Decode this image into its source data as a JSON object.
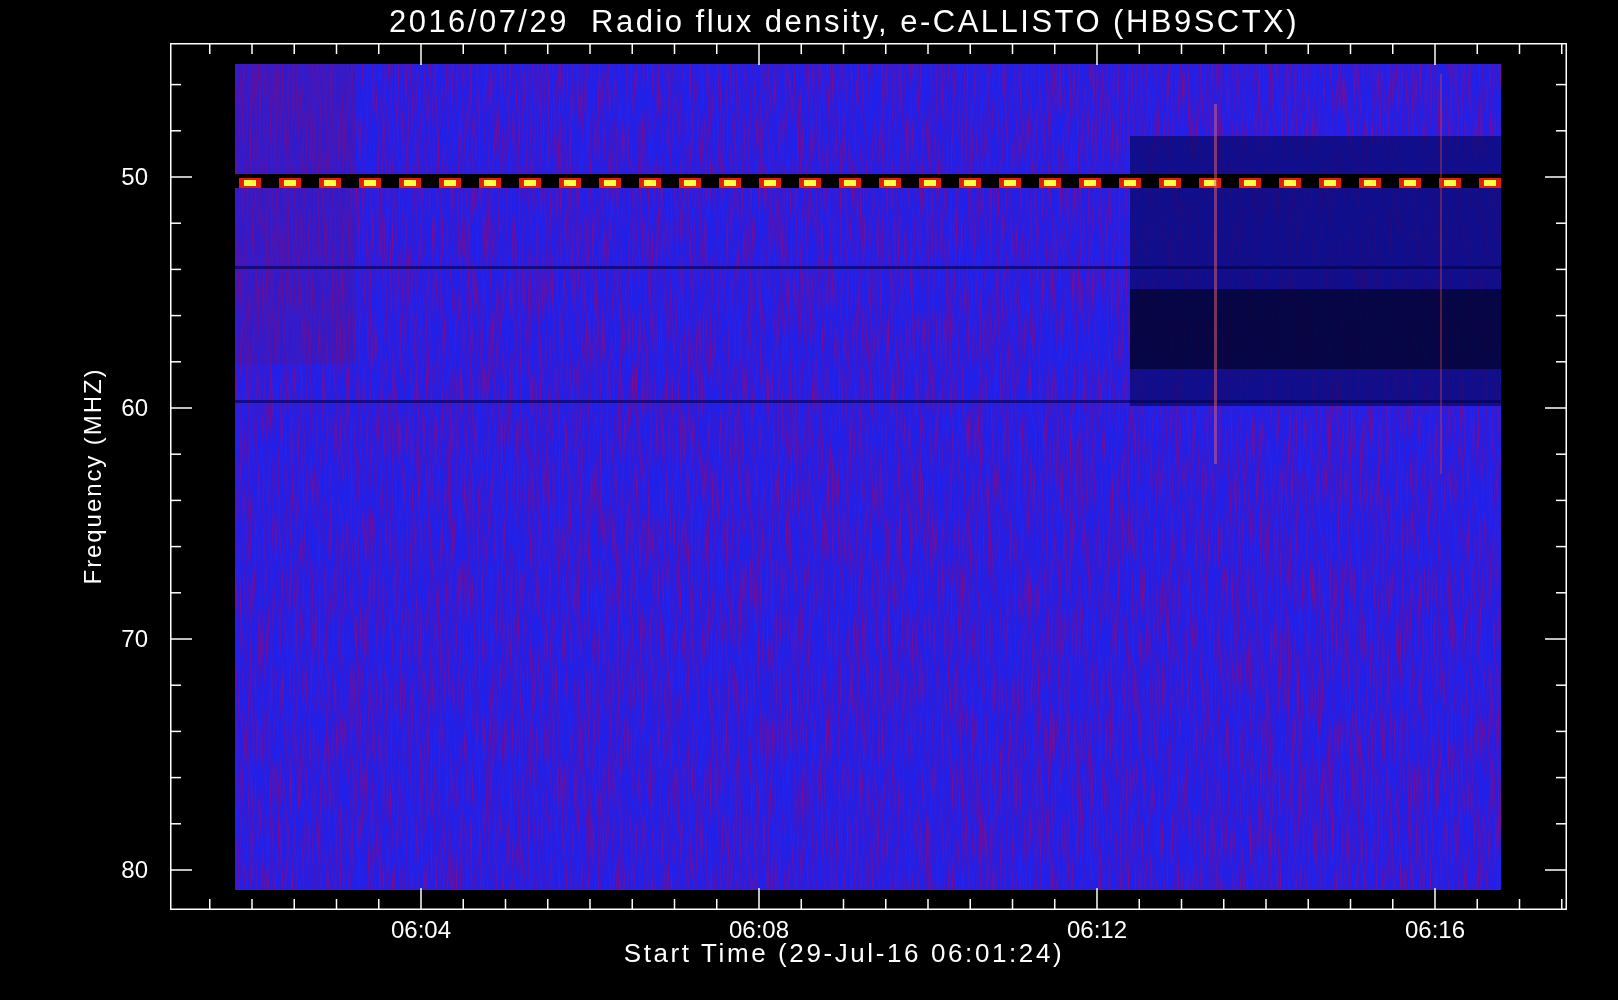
{
  "title": "2016/07/29  Radio flux density, e-CALLISTO (HB9SCTX)",
  "y_axis": {
    "label": "Frequency (MHZ)",
    "ticks": [
      "50",
      "60",
      "70",
      "80"
    ]
  },
  "x_axis": {
    "label": "Start Time (29-Jul-16 06:01:24)",
    "ticks": [
      "06:04",
      "06:08",
      "06:12",
      "06:16"
    ]
  }
}
